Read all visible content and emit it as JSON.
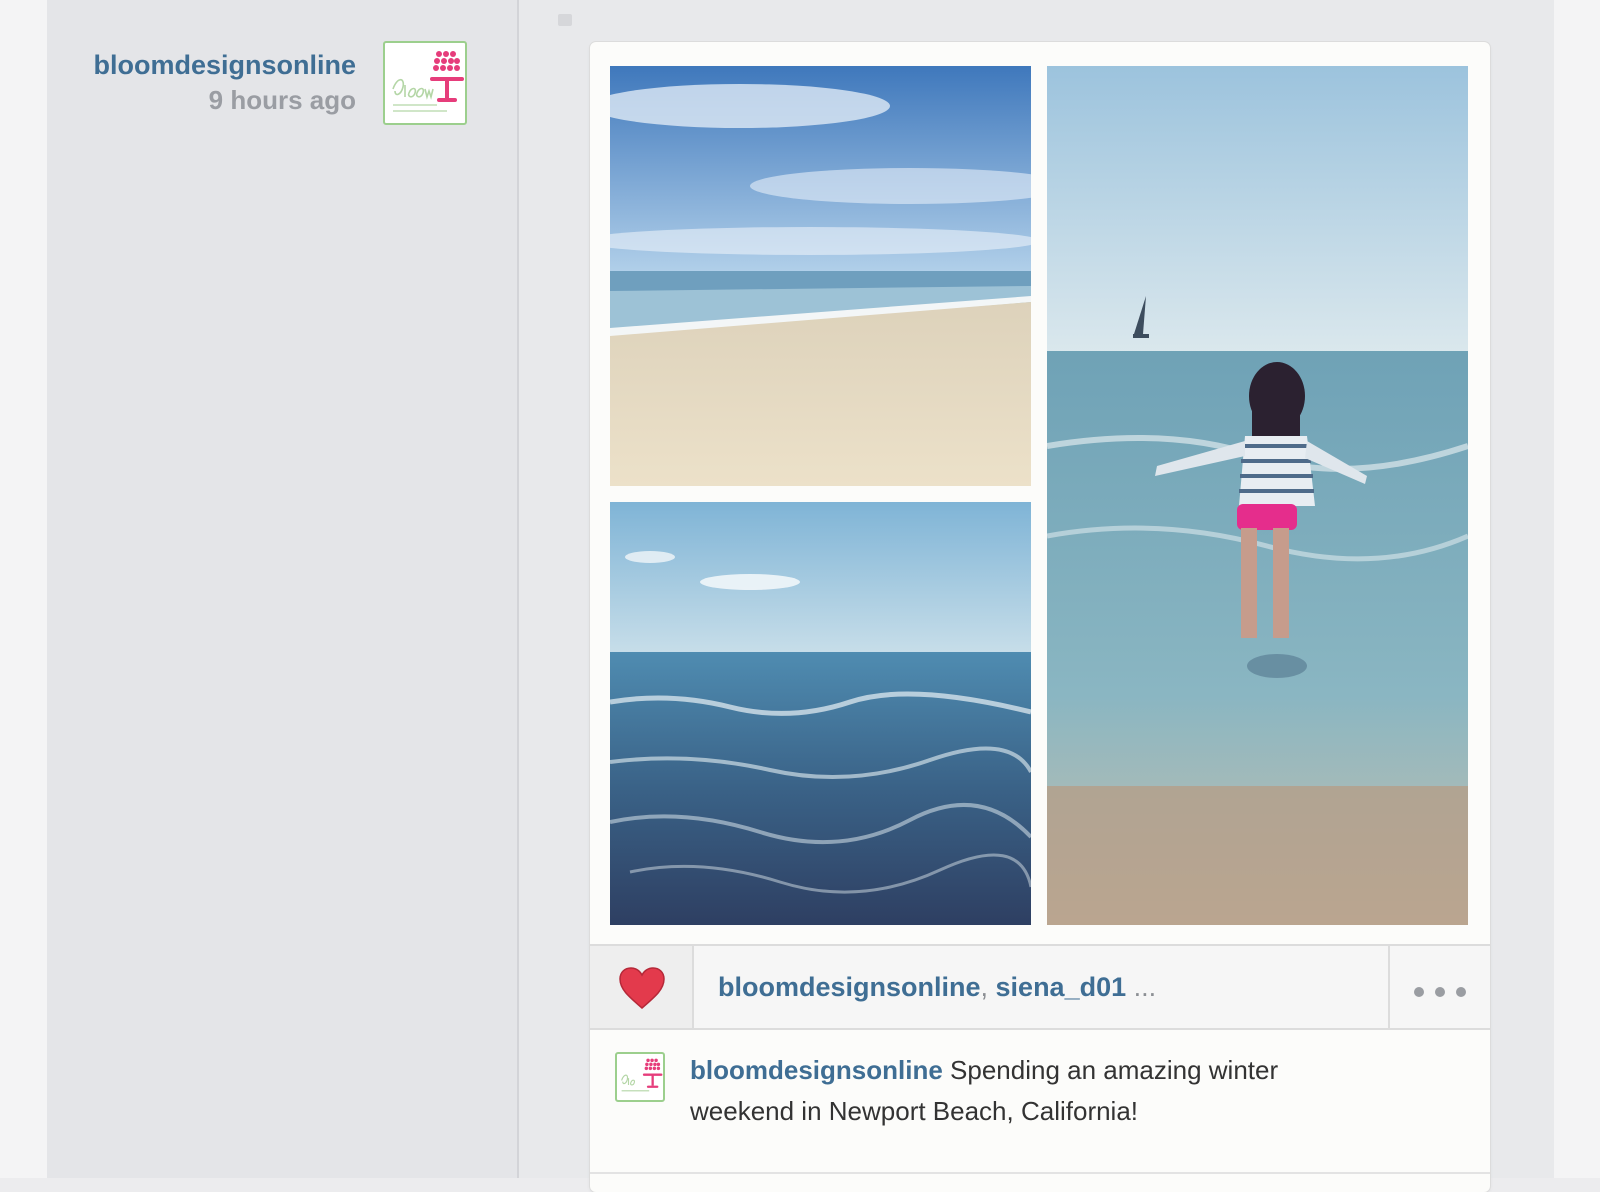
{
  "post": {
    "author": "bloomdesignsonline",
    "time": "9 hours ago",
    "avatar_icon": "bloom-logo-icon"
  },
  "likes": {
    "users": [
      "bloomdesignsonline",
      "siena_d01"
    ],
    "separator": ", ",
    "overflow": "..."
  },
  "caption": {
    "username": "bloomdesignsonline",
    "text": "Spending an amazing winter weekend in Newport Beach, California!"
  },
  "colors": {
    "link_blue": "#3f6e94",
    "heart_red": "#e33a4c",
    "muted_gray": "#9a9da3",
    "logo_pink": "#e63d7b",
    "logo_green": "#9ccf8d"
  }
}
